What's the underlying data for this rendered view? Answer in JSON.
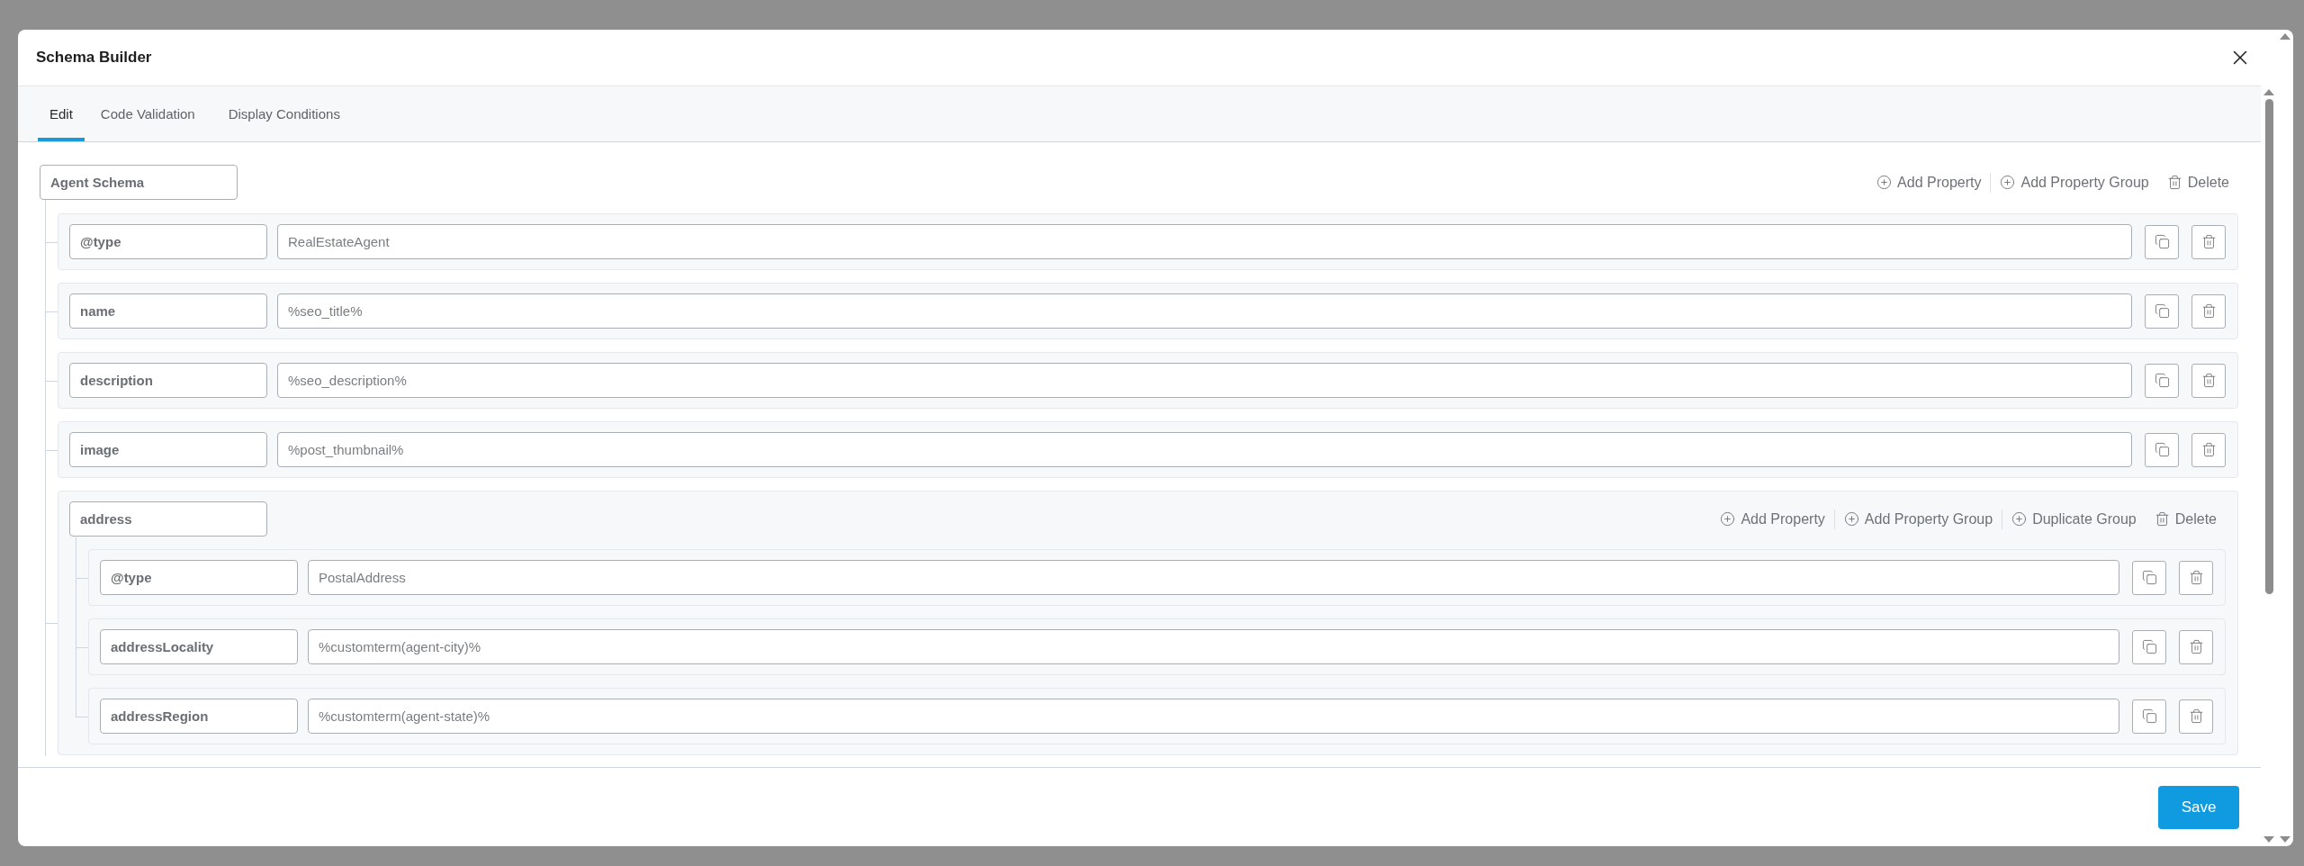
{
  "dialog": {
    "title": "Schema Builder"
  },
  "tabs": [
    {
      "label": "Edit",
      "selected": true
    },
    {
      "label": "Code Validation",
      "selected": false
    },
    {
      "label": "Display Conditions",
      "selected": false
    }
  ],
  "schema": {
    "name": "Agent Schema",
    "actions": [
      {
        "kind": "add",
        "label": "Add Property"
      },
      {
        "kind": "add",
        "label": "Add Property Group"
      },
      {
        "kind": "delete",
        "label": "Delete"
      }
    ],
    "properties": [
      {
        "kind": "property",
        "key": "@type",
        "value": "RealEstateAgent"
      },
      {
        "kind": "property",
        "key": "name",
        "value": "%seo_title%"
      },
      {
        "kind": "property",
        "key": "description",
        "value": "%seo_description%"
      },
      {
        "kind": "property",
        "key": "image",
        "value": "%post_thumbnail%"
      },
      {
        "kind": "group",
        "key": "address",
        "actions": [
          {
            "kind": "add",
            "label": "Add Property"
          },
          {
            "kind": "add",
            "label": "Add Property Group"
          },
          {
            "kind": "add",
            "label": "Duplicate Group"
          },
          {
            "kind": "delete",
            "label": "Delete"
          }
        ],
        "children": [
          {
            "kind": "property",
            "key": "@type",
            "value": "PostalAddress"
          },
          {
            "kind": "property",
            "key": "addressLocality",
            "value": "%customterm(agent-city)%"
          },
          {
            "kind": "property",
            "key": "addressRegion",
            "value": "%customterm(agent-state)%"
          }
        ]
      }
    ]
  },
  "footer": {
    "save": "Save"
  }
}
